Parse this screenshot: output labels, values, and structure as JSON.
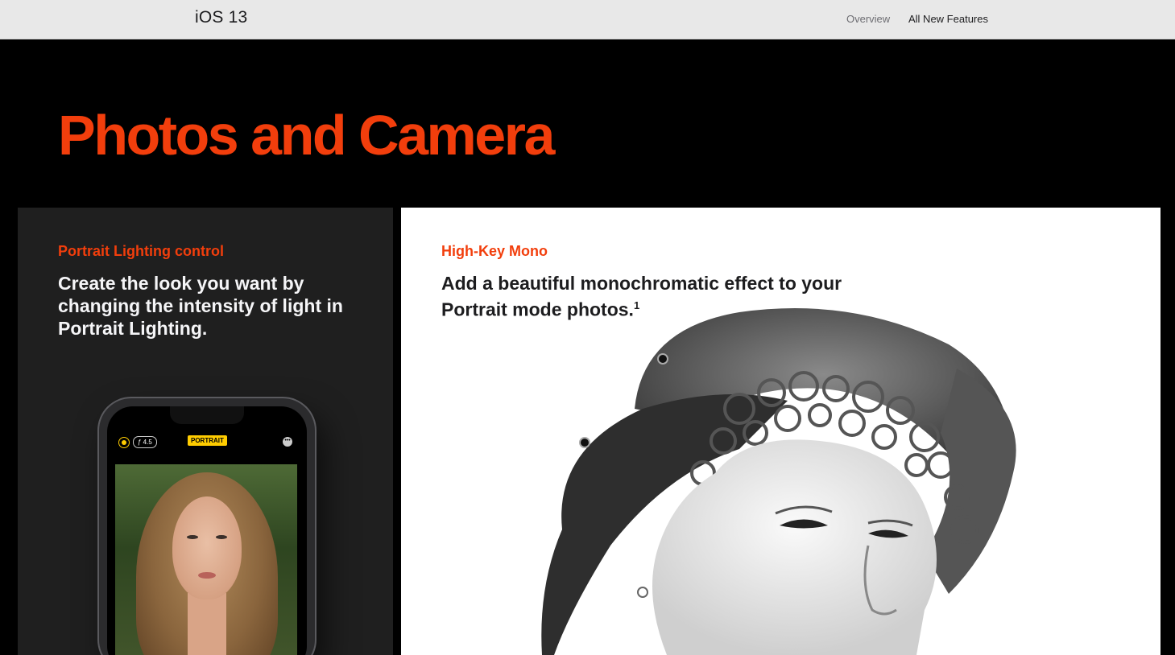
{
  "nav": {
    "brand": "iOS 13",
    "links": [
      "Overview",
      "All New Features"
    ]
  },
  "page": {
    "headline": "Photos and Camera",
    "accent_color": "#f23e0c"
  },
  "tiles": [
    {
      "eyebrow": "Portrait Lighting control",
      "body": "Create the look you want by changing the intensity of light in Portrait Lighting.",
      "camera_ui": {
        "fstop": "ƒ 4.5",
        "mode": "PORTRAIT",
        "icons": [
          "flash-icon",
          "more-icon"
        ]
      }
    },
    {
      "eyebrow": "High-Key Mono",
      "body": "Add a beautiful monochromatic effect to your Portrait mode photos.",
      "footnote": "1"
    }
  ]
}
